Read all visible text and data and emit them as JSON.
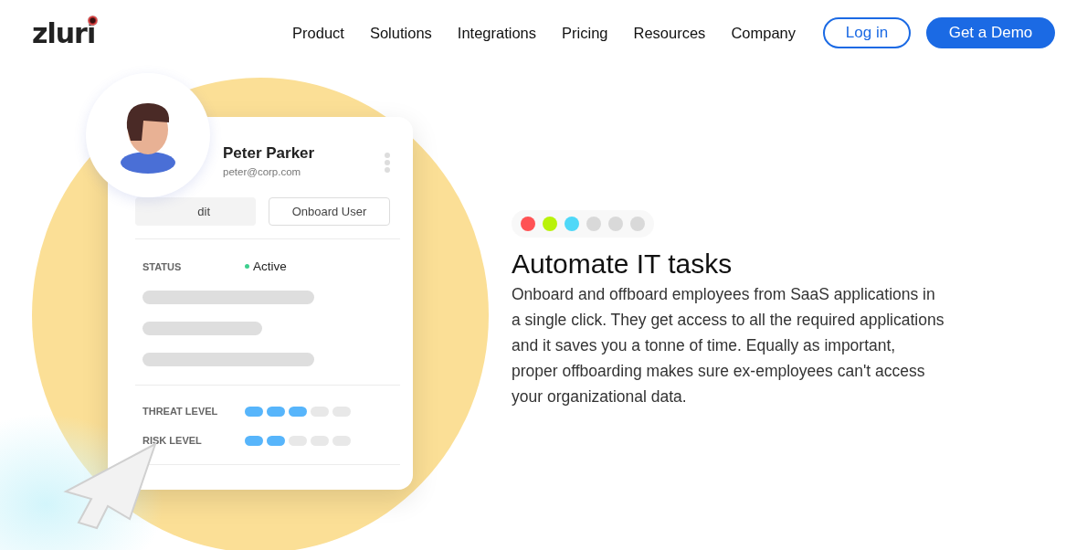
{
  "nav": {
    "logo": "zluri",
    "links": [
      "Product",
      "Solutions",
      "Integrations",
      "Pricing",
      "Resources",
      "Company"
    ],
    "login": "Log in",
    "demo": "Get a Demo"
  },
  "card": {
    "name": "Peter Parker",
    "email": "peter@corp.com",
    "edit_button": "dit",
    "onboard_button": "Onboard User",
    "status_label": "STATUS",
    "status_value": "Active",
    "levels": [
      {
        "label": "THREAT LEVEL",
        "level": 0.6
      },
      {
        "label": "RISK LEVEL",
        "level": 0.4
      }
    ]
  },
  "dots": [
    {
      "color": "#ff5254"
    },
    {
      "color": "#b9f20a"
    },
    {
      "color": "#4fd8f8"
    },
    {
      "color": "#d9d9d9"
    },
    {
      "color": "#d9d9d9"
    },
    {
      "color": "#d9d9d9"
    }
  ],
  "hero": {
    "title": "Automate IT tasks",
    "text": "Onboard and offboard employees from SaaS applications in a single click. They get access to all the required applications and it saves you a tonne of time. Equally as important, proper offboarding makes sure ex-employees can't access your organizational data."
  }
}
